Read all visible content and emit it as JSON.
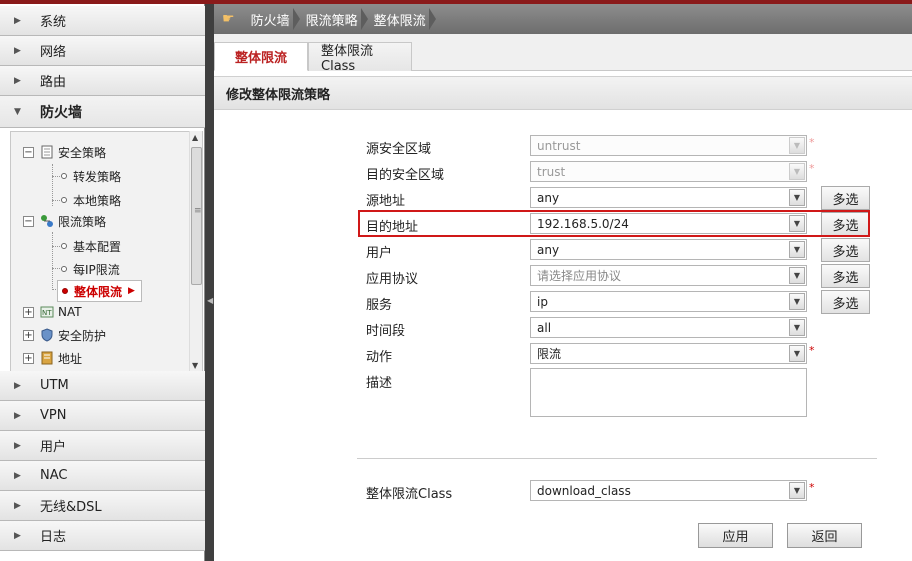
{
  "sidebar": {
    "sections_top": [
      {
        "label": "系统"
      },
      {
        "label": "网络"
      },
      {
        "label": "路由"
      }
    ],
    "open_section": {
      "label": "防火墙"
    },
    "tree": {
      "security_policy": "安全策略",
      "forward_policy": "转发策略",
      "local_policy": "本地策略",
      "rate_limit_policy": "限流策略",
      "basic_config": "基本配置",
      "per_ip_limit": "每IP限流",
      "overall_limit": "整体限流",
      "nat": "NAT",
      "security_protection": "安全防护",
      "address": "地址"
    },
    "sections_bottom": [
      {
        "label": "UTM"
      },
      {
        "label": "VPN"
      },
      {
        "label": "用户"
      },
      {
        "label": "NAC"
      },
      {
        "label": "无线&DSL"
      },
      {
        "label": "日志"
      }
    ]
  },
  "breadcrumb": [
    "防火墙",
    "限流策略",
    "整体限流"
  ],
  "tabs": {
    "active": "整体限流",
    "inactive": "整体限流Class"
  },
  "panel_title": "修改整体限流策略",
  "form": {
    "src_zone": {
      "label": "源安全区域",
      "value": "untrust"
    },
    "dst_zone": {
      "label": "目的安全区域",
      "value": "trust"
    },
    "src_addr": {
      "label": "源地址",
      "value": "any"
    },
    "dst_addr": {
      "label": "目的地址",
      "value": "192.168.5.0/24"
    },
    "user": {
      "label": "用户",
      "value": "any"
    },
    "app": {
      "label": "应用协议",
      "value": "请选择应用协议"
    },
    "service": {
      "label": "服务",
      "value": "ip"
    },
    "schedule": {
      "label": "时间段",
      "value": "all"
    },
    "action": {
      "label": "动作",
      "value": "限流"
    },
    "description": {
      "label": "描述",
      "value": ""
    },
    "limit_class": {
      "label": "整体限流Class",
      "value": "download_class"
    },
    "multi_select_label": "多选",
    "required_mark": "*"
  },
  "buttons": {
    "apply": "应用",
    "back": "返回"
  },
  "colors": {
    "accent": "#b22222",
    "highlight": "#d01818",
    "topbar": "#8a1a1a"
  }
}
